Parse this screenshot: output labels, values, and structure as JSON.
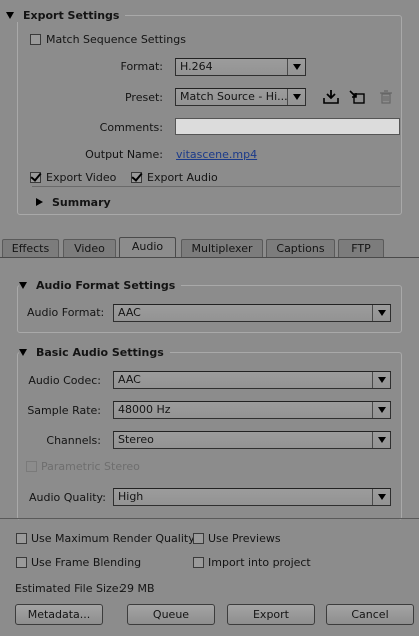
{
  "export_settings": {
    "header": "Export Settings",
    "match_sequence_label": "Match Sequence Settings",
    "format_label": "Format:",
    "format_value": "H.264",
    "preset_label": "Preset:",
    "preset_value": "Match Source - Hi...",
    "comments_label": "Comments:",
    "comments_value": "",
    "output_name_label": "Output Name:",
    "output_name_value": "vitascene.mp4",
    "export_video_label": "Export Video",
    "export_audio_label": "Export Audio",
    "summary_label": "Summary",
    "icons": [
      "save-preset-icon",
      "import-preset-icon",
      "delete-preset-icon"
    ]
  },
  "tabs": [
    {
      "label": "Effects",
      "active": false
    },
    {
      "label": "Video",
      "active": false
    },
    {
      "label": "Audio",
      "active": true
    },
    {
      "label": "Multiplexer",
      "active": false
    },
    {
      "label": "Captions",
      "active": false
    },
    {
      "label": "FTP",
      "active": false
    }
  ],
  "audio_format": {
    "header": "Audio Format Settings",
    "format_label": "Audio Format:",
    "format_value": "AAC"
  },
  "basic_audio": {
    "header": "Basic Audio Settings",
    "codec_label": "Audio Codec:",
    "codec_value": "AAC",
    "sample_rate_label": "Sample Rate:",
    "sample_rate_value": "48000 Hz",
    "channels_label": "Channels:",
    "channels_value": "Stereo",
    "parametric_stereo_label": "Parametric Stereo",
    "quality_label": "Audio Quality:",
    "quality_value": "High"
  },
  "footer": {
    "max_render_label": "Use Maximum Render Quality",
    "use_previews_label": "Use Previews",
    "frame_blending_label": "Use Frame Blending",
    "import_project_label": "Import into project",
    "file_size_label": "Estimated File Size:",
    "file_size_value": "29 MB",
    "metadata_button": "Metadata...",
    "queue_button": "Queue",
    "export_button": "Export",
    "cancel_button": "Cancel"
  },
  "colors": {
    "background": "#8c8c8c",
    "link": "#1a3a8a",
    "text": "#141414"
  }
}
